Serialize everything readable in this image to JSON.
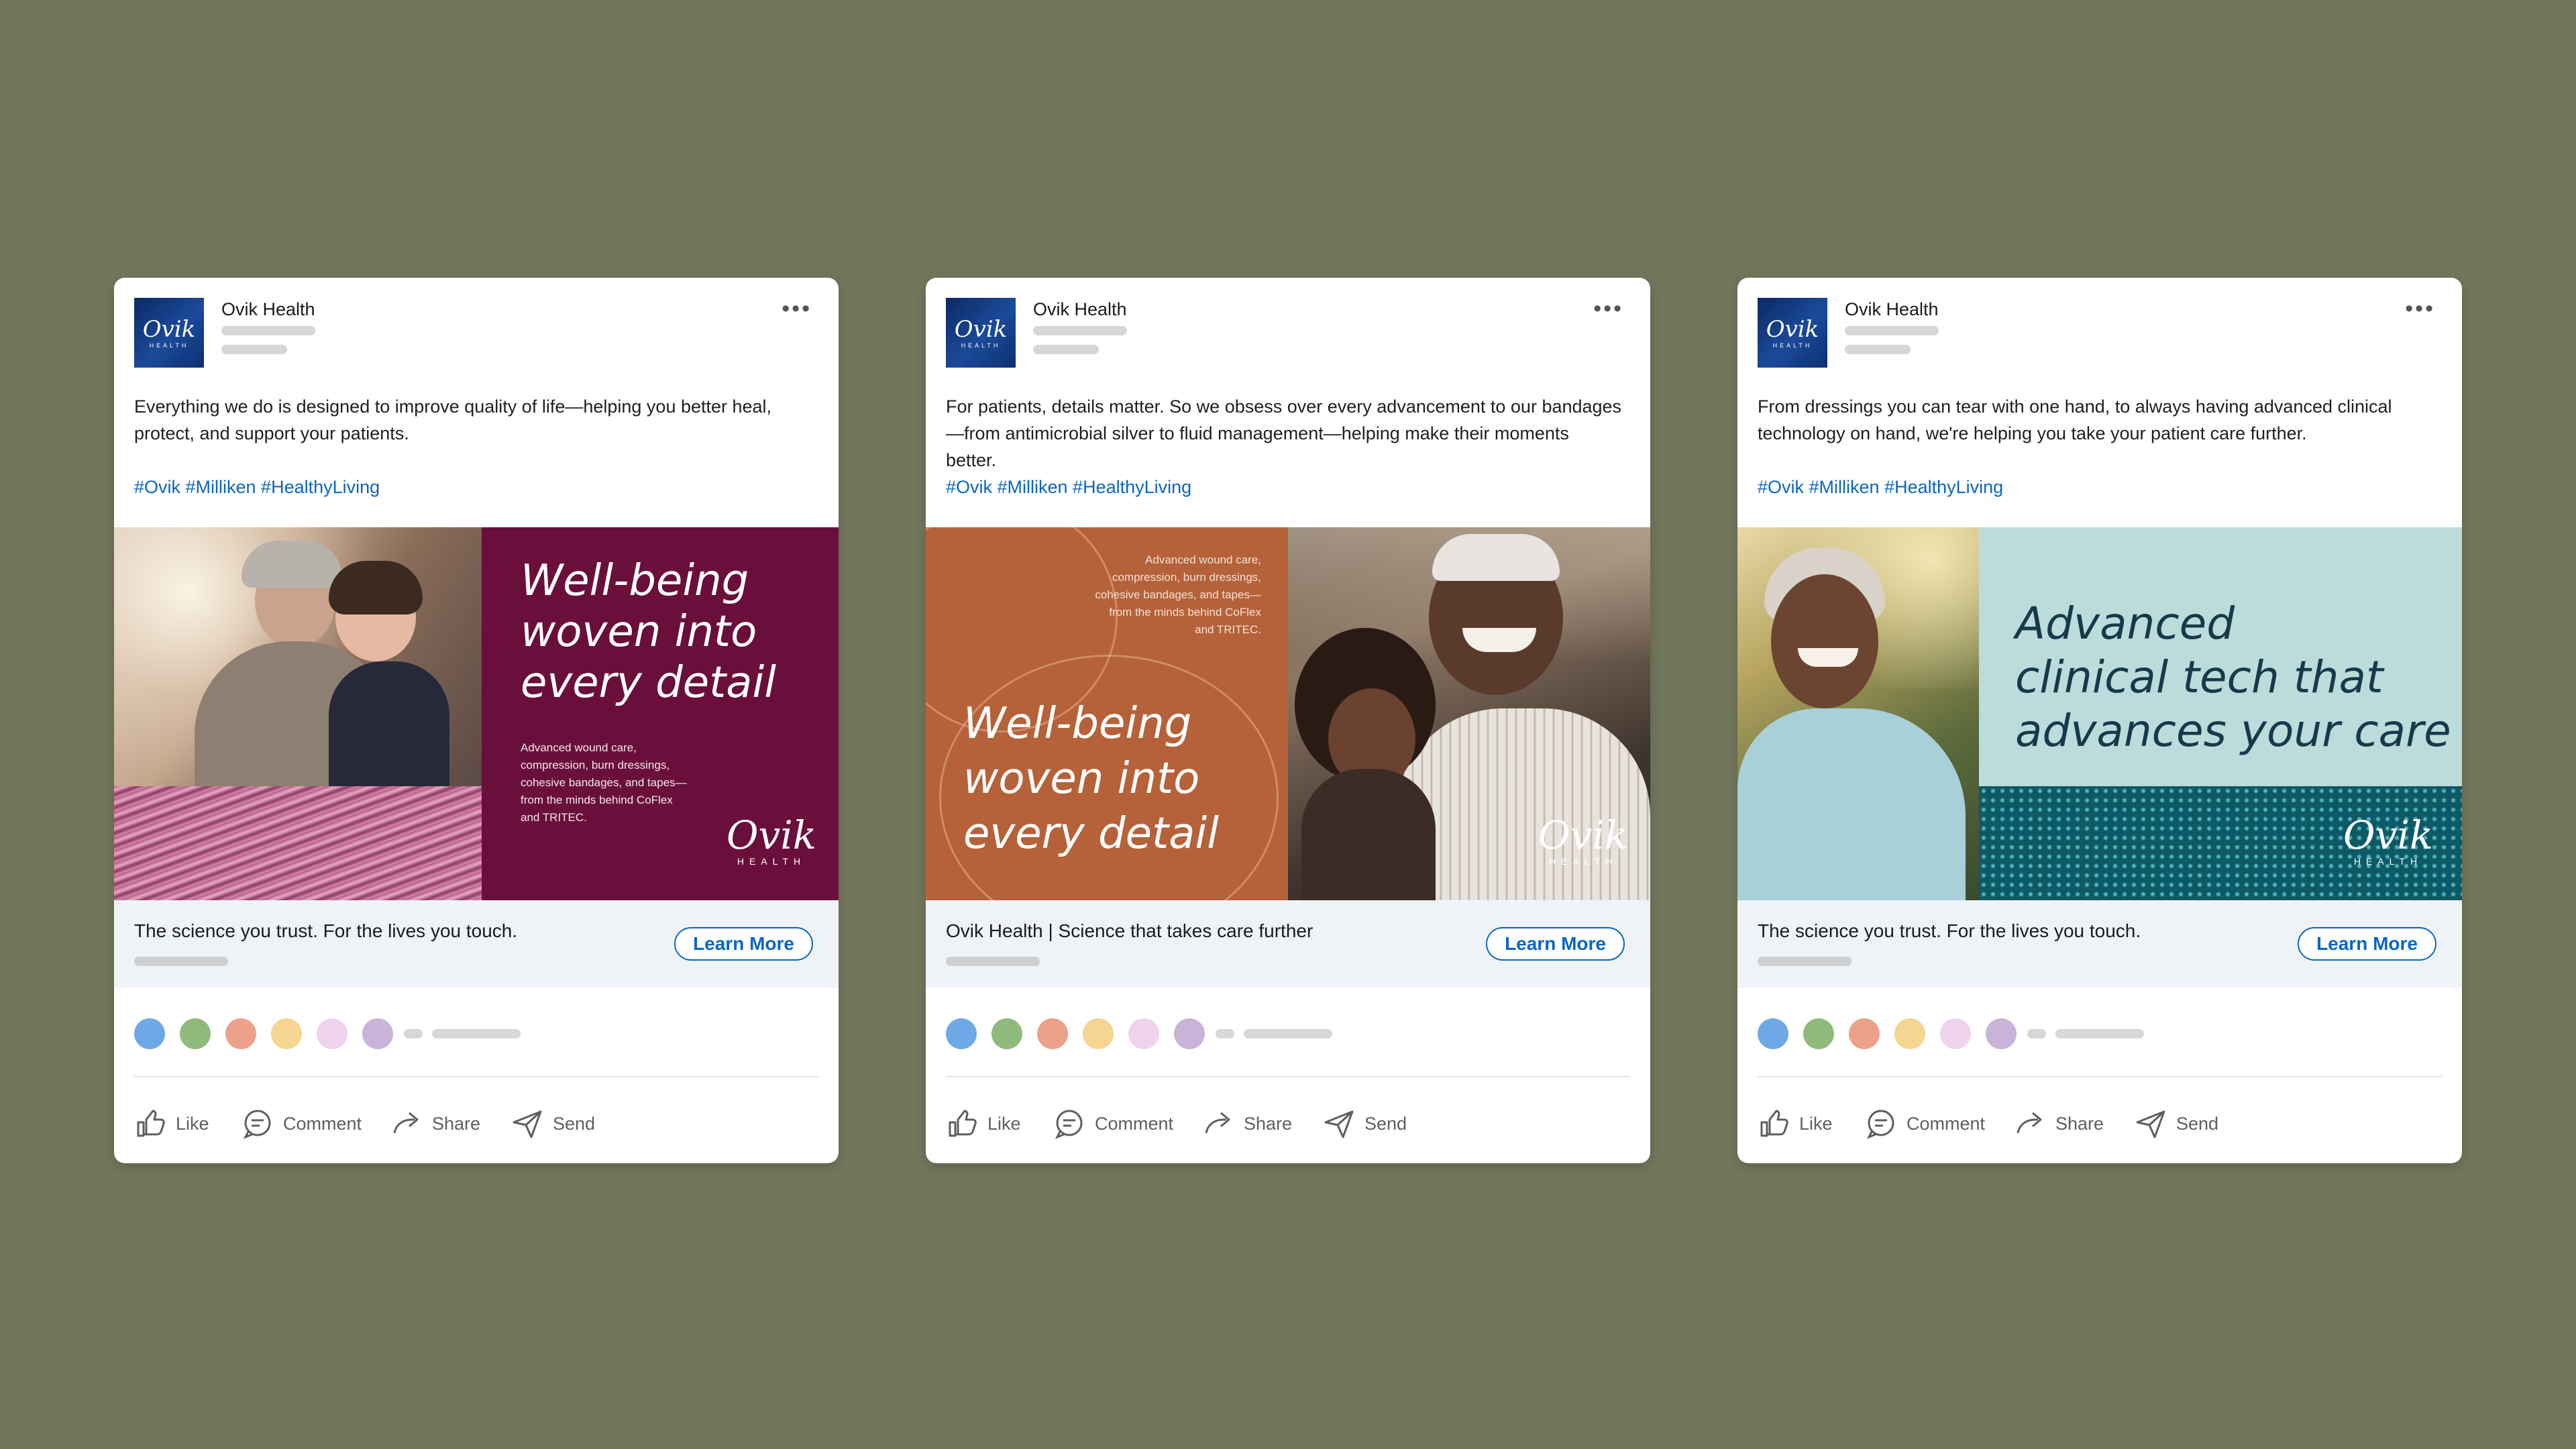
{
  "posts": [
    {
      "org": "Ovik Health",
      "logo_text": "Ovik",
      "logo_sub": "HEALTH",
      "body": "Everything we do is designed to improve quality of life—helping you better heal, protect, and support your patients.",
      "hashtags": "#Ovik #Milliken #HealthyLiving",
      "image": {
        "headline": [
          "Well-being",
          "woven into",
          "every detail"
        ],
        "subcopy": [
          "Advanced wound care,",
          "compression, burn dressings,",
          "cohesive bandages, and tapes—",
          "from the minds behind CoFlex",
          "and TRITEC."
        ],
        "brand": "Ovik",
        "brand_sub": "HEALTH",
        "accent": "#6a0f3c"
      },
      "cta_text": "The science you trust. For the lives you touch.",
      "cta_button": "Learn More"
    },
    {
      "org": "Ovik Health",
      "logo_text": "Ovik",
      "logo_sub": "HEALTH",
      "body": "For patients, details matter. So we obsess over every advancement to our bandages—from antimicrobial silver to fluid management—helping make their moments better.",
      "hashtags": "#Ovik #Milliken #HealthyLiving",
      "image": {
        "headline": [
          "Well-being",
          "woven into",
          "every detail"
        ],
        "subcopy": [
          "Advanced wound care,",
          "compression, burn dressings,",
          "cohesive bandages, and tapes—",
          "from the minds behind CoFlex",
          "and TRITEC."
        ],
        "brand": "Ovik",
        "brand_sub": "HEALTH",
        "accent": "#b5623a"
      },
      "cta_text": "Ovik Health | Science that takes care further",
      "cta_button": "Learn More"
    },
    {
      "org": "Ovik Health",
      "logo_text": "Ovik",
      "logo_sub": "HEALTH",
      "body": "From dressings you can tear with one hand, to always having advanced clinical technology on hand, we're helping you take your patient care further.",
      "hashtags": "#Ovik #Milliken #HealthyLiving",
      "image": {
        "headline": [
          "Advanced",
          "clinical tech that",
          "advances your care"
        ],
        "brand": "Ovik",
        "brand_sub": "HEALTH",
        "accent": "#bcdcdc"
      },
      "cta_text": "The science you trust. For the lives you touch.",
      "cta_button": "Learn More"
    }
  ],
  "reaction_colors": [
    "#6fa8e6",
    "#8fba7c",
    "#eda08a",
    "#f5d58f",
    "#efd3ee",
    "#c7b4d8"
  ],
  "actions": {
    "like": "Like",
    "comment": "Comment",
    "share": "Share",
    "send": "Send"
  }
}
